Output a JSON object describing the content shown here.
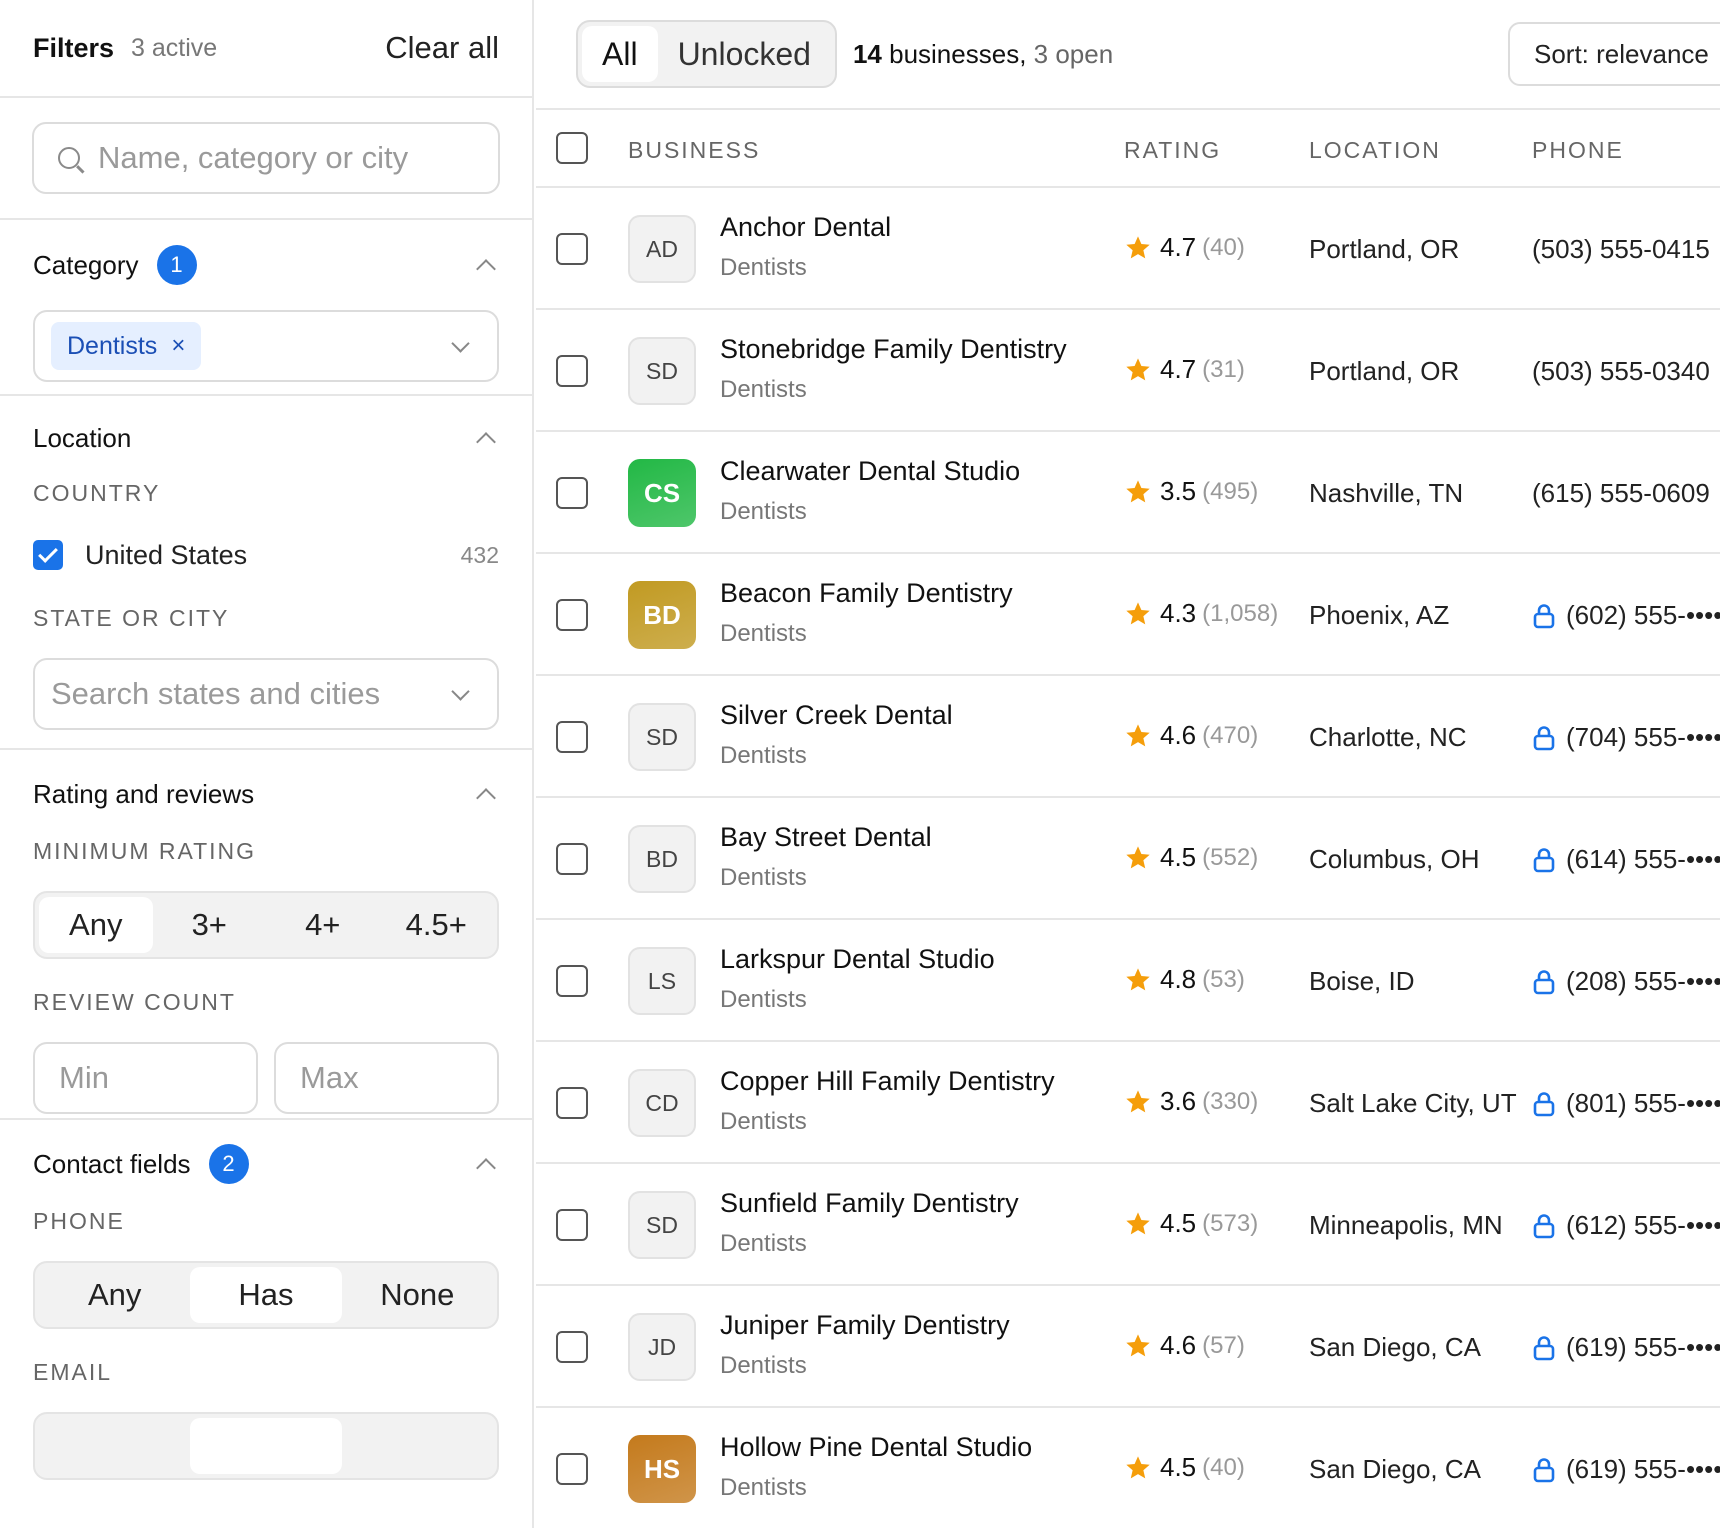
{
  "filters": {
    "title": "Filters",
    "active": "3 active",
    "clear_all": "Clear all",
    "search_placeholder": "Name, category or city",
    "category": {
      "title": "Category",
      "badge": "1",
      "chip": "Dentists",
      "chip_remove": "×"
    },
    "location": {
      "title": "Location",
      "country_label": "COUNTRY",
      "country": "United States",
      "country_count": "432",
      "country_checked": true,
      "state_label": "STATE OR CITY",
      "state_placeholder": "Search states and cities"
    },
    "rating": {
      "title": "Rating and reviews",
      "min_label": "MINIMUM RATING",
      "options": [
        "Any",
        "3+",
        "4+",
        "4.5+"
      ],
      "selected": "Any",
      "review_label": "REVIEW COUNT",
      "min_placeholder": "Min",
      "max_placeholder": "Max"
    },
    "contact": {
      "title": "Contact fields",
      "badge": "2",
      "phone_label": "PHONE",
      "phone_options": [
        "Any",
        "Has",
        "None"
      ],
      "phone_selected": "Has",
      "email_label": "EMAIL"
    }
  },
  "toolbar": {
    "tabs": [
      "All",
      "Unlocked"
    ],
    "active_tab": "All",
    "count_num": "14",
    "count_text": " businesses, ",
    "open_text": "3 open",
    "sort": "Sort: relevance"
  },
  "table": {
    "headers": {
      "business": "BUSINESS",
      "rating": "RATING",
      "location": "LOCATION",
      "phone": "PHONE"
    },
    "rows": [
      {
        "initials": "AD",
        "name": "Anchor Dental",
        "category": "Dentists",
        "rating": "4.7",
        "reviews": "(40)",
        "location": "Portland, OR",
        "phone": "(503) 555-0415",
        "locked": false,
        "avatar_color": ""
      },
      {
        "initials": "SD",
        "name": "Stonebridge Family Dentistry",
        "category": "Dentists",
        "rating": "4.7",
        "reviews": "(31)",
        "location": "Portland, OR",
        "phone": "(503) 555-0340",
        "locked": false,
        "avatar_color": ""
      },
      {
        "initials": "CS",
        "name": "Clearwater Dental Studio",
        "category": "Dentists",
        "rating": "3.5",
        "reviews": "(495)",
        "location": "Nashville, TN",
        "phone": "(615) 555-0609",
        "locked": false,
        "avatar_color": "#22b845"
      },
      {
        "initials": "BD",
        "name": "Beacon Family Dentistry",
        "category": "Dentists",
        "rating": "4.3",
        "reviews": "(1,058)",
        "location": "Phoenix, AZ",
        "phone": "(602) 555-••••",
        "locked": true,
        "avatar_color": "#c19a22"
      },
      {
        "initials": "SD",
        "name": "Silver Creek Dental",
        "category": "Dentists",
        "rating": "4.6",
        "reviews": "(470)",
        "location": "Charlotte, NC",
        "phone": "(704) 555-••••",
        "locked": true,
        "avatar_color": ""
      },
      {
        "initials": "BD",
        "name": "Bay Street Dental",
        "category": "Dentists",
        "rating": "4.5",
        "reviews": "(552)",
        "location": "Columbus, OH",
        "phone": "(614) 555-••••",
        "locked": true,
        "avatar_color": ""
      },
      {
        "initials": "LS",
        "name": "Larkspur Dental Studio",
        "category": "Dentists",
        "rating": "4.8",
        "reviews": "(53)",
        "location": "Boise, ID",
        "phone": "(208) 555-••••",
        "locked": true,
        "avatar_color": ""
      },
      {
        "initials": "CD",
        "name": "Copper Hill Family Dentistry",
        "category": "Dentists",
        "rating": "3.6",
        "reviews": "(330)",
        "location": "Salt Lake City, UT",
        "phone": "(801) 555-••••",
        "locked": true,
        "avatar_color": ""
      },
      {
        "initials": "SD",
        "name": "Sunfield Family Dentistry",
        "category": "Dentists",
        "rating": "4.5",
        "reviews": "(573)",
        "location": "Minneapolis, MN",
        "phone": "(612) 555-••••",
        "locked": true,
        "avatar_color": ""
      },
      {
        "initials": "JD",
        "name": "Juniper Family Dentistry",
        "category": "Dentists",
        "rating": "4.6",
        "reviews": "(57)",
        "location": "San Diego, CA",
        "phone": "(619) 555-••••",
        "locked": true,
        "avatar_color": ""
      },
      {
        "initials": "HS",
        "name": "Hollow Pine Dental Studio",
        "category": "Dentists",
        "rating": "4.5",
        "reviews": "(40)",
        "location": "San Diego, CA",
        "phone": "(619) 555-••••",
        "locked": true,
        "avatar_color": "#c47a1c"
      }
    ]
  },
  "colors": {
    "accent": "#1a73e8",
    "star": "#f59e0b"
  }
}
